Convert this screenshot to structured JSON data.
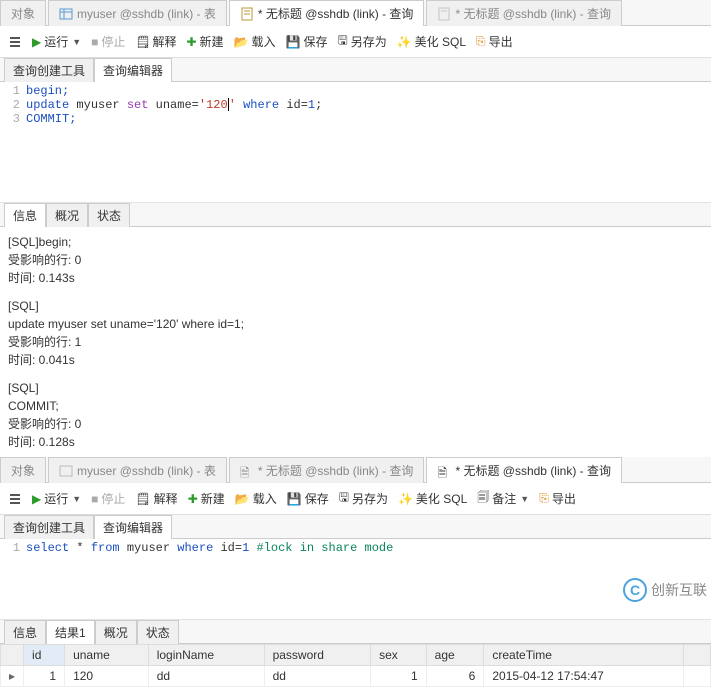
{
  "top": {
    "tabs": {
      "objects": "对象",
      "table": "myuser @sshdb (link) - 表",
      "q1": "* 无标题 @sshdb (link) - 查询",
      "q2": "* 无标题 @sshdb (link) - 查询"
    },
    "toolbar": {
      "run": "运行",
      "stop": "停止",
      "explain": "解释",
      "new": "新建",
      "load": "载入",
      "save": "保存",
      "save_as": "另存为",
      "beautify": "美化 SQL",
      "export": "导出"
    },
    "subtabs": {
      "builder": "查询创建工具",
      "editor": "查询编辑器"
    },
    "code": {
      "l1": "begin;",
      "l2a": "update",
      "l2b": "myuser",
      "l2c": "set",
      "l2d": "uname=",
      "l2e": "'120",
      "l2f": "'",
      "l2g": "where",
      "l2h": "id=",
      "l2i": "1",
      "l2j": ";",
      "l3": "COMMIT;"
    },
    "logtabs": {
      "info": "信息",
      "profile": "概况",
      "status": "状态"
    },
    "log": {
      "b1a": "[SQL]begin;",
      "b1b": "受影响的行: 0",
      "b1c": "时间: 0.143s",
      "b2a": "[SQL]",
      "b2b": "update myuser set uname='120' where id=1;",
      "b2c": "受影响的行: 1",
      "b2d": "时间: 0.041s",
      "b3a": "[SQL]",
      "b3b": "COMMIT;",
      "b3c": "受影响的行: 0",
      "b3d": "时间: 0.128s"
    }
  },
  "bottom": {
    "tabs": {
      "objects": "对象",
      "table": "myuser @sshdb (link) - 表",
      "q1": "* 无标题 @sshdb (link) - 查询",
      "q2": "* 无标题 @sshdb (link) - 查询"
    },
    "toolbar": {
      "run": "运行",
      "stop": "停止",
      "explain": "解释",
      "new": "新建",
      "load": "载入",
      "save": "保存",
      "save_as": "另存为",
      "beautify": "美化 SQL",
      "notes": "备注",
      "export": "导出"
    },
    "subtabs": {
      "builder": "查询创建工具",
      "editor": "查询编辑器"
    },
    "code": {
      "l1a": "select",
      "l1b": "*",
      "l1c": "from",
      "l1d": "myuser",
      "l1e": "where",
      "l1f": "id=",
      "l1g": "1",
      "l1h": "#lock in share mode"
    },
    "restabs": {
      "info": "信息",
      "result": "结果1",
      "profile": "概况",
      "status": "状态"
    },
    "grid": {
      "cols": {
        "id": "id",
        "uname": "uname",
        "loginName": "loginName",
        "password": "password",
        "sex": "sex",
        "age": "age",
        "createTime": "createTime"
      },
      "row": {
        "id": "1",
        "uname": "120",
        "loginName": "dd",
        "password": "dd",
        "sex": "1",
        "age": "6",
        "createTime": "2015-04-12 17:54:47"
      },
      "ptr": "▸"
    }
  },
  "watermark": {
    "logo": "C",
    "text": "创新互联"
  }
}
